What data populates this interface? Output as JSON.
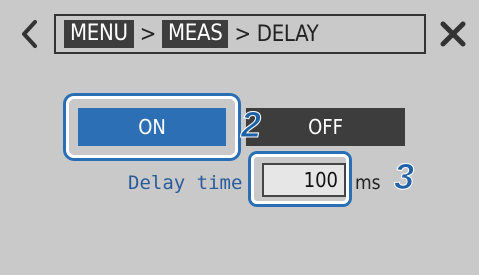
{
  "breadcrumb": {
    "items": [
      "MENU",
      "MEAS",
      "DELAY"
    ],
    "separator": ">"
  },
  "icons": {
    "back": "chevron-left-icon",
    "close": "close-x-icon"
  },
  "toggle": {
    "on_label": "ON",
    "off_label": "OFF",
    "selected": "ON"
  },
  "delay": {
    "label": "Delay time",
    "value": "100",
    "unit": "ms"
  },
  "steps": {
    "step_2": "2",
    "step_3": "3"
  },
  "colors": {
    "accent": "#2c6fb4",
    "background": "#c9c9c9",
    "dark": "#3d3d3d"
  }
}
